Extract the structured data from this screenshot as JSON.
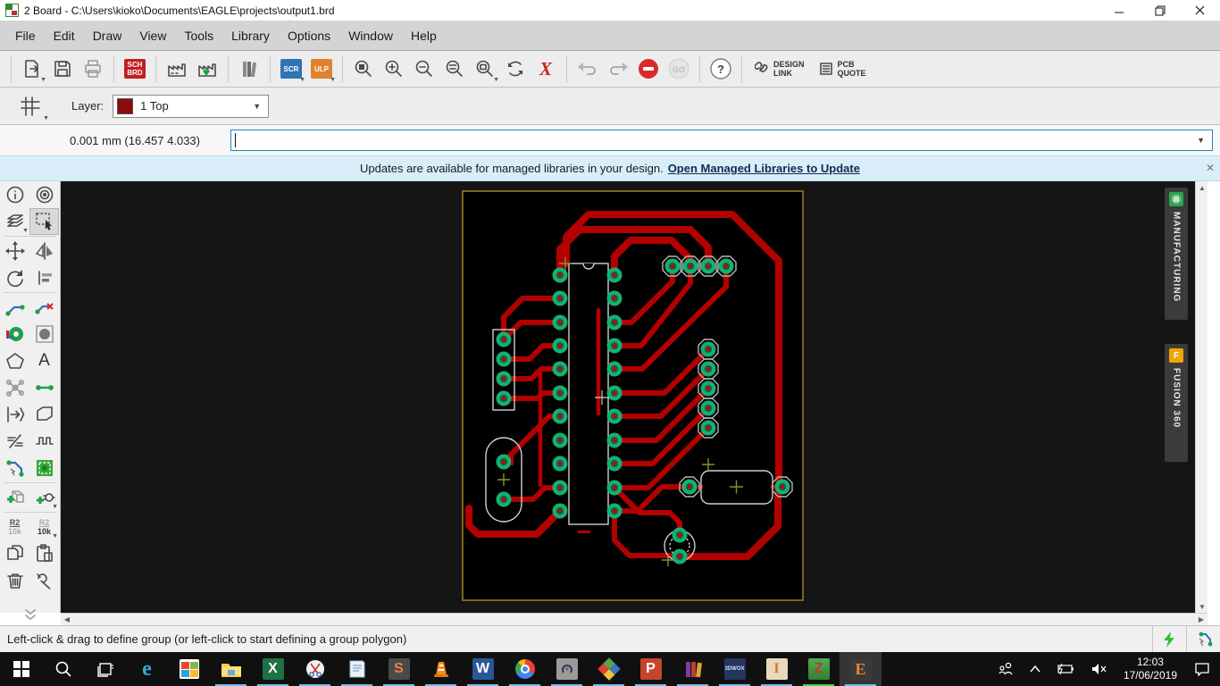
{
  "window": {
    "title": "2 Board - C:\\Users\\kioko\\Documents\\EAGLE\\projects\\output1.brd"
  },
  "menu": {
    "items": [
      "File",
      "Edit",
      "Draw",
      "View",
      "Tools",
      "Library",
      "Options",
      "Window",
      "Help"
    ]
  },
  "toolbar": {
    "sch": "SCH",
    "brd": "BRD",
    "scr": "SCR",
    "ulp": "ULP",
    "go": "GO",
    "help": "?",
    "design_link_1": "DESIGN",
    "design_link_2": "LINK",
    "pcb_quote_1": "PCB",
    "pcb_quote_2": "QUOTE"
  },
  "layer_bar": {
    "label": "Layer:",
    "selected": "1 Top",
    "swatch_color": "#8e0b0b"
  },
  "command_bar": {
    "coords": "0.001 mm (16.457 4.033)",
    "value": ""
  },
  "notification": {
    "message": "Updates are available for managed libraries in your design.",
    "link": "Open Managed Libraries to Update",
    "close": "✕"
  },
  "palette": {
    "name_top": "R2",
    "name_bottom": "10k",
    "value_top": "R2",
    "value_bottom": "10k"
  },
  "side_tabs": {
    "manufacturing": "MANUFACTURING",
    "fusion": "FUSION 360",
    "fusion_icon": "F"
  },
  "status_bar": {
    "hint": "Left-click & drag to define group (or left-click to start defining a group polygon)"
  },
  "taskbar": {
    "time": "12:03",
    "date": "17/06/2019",
    "letters": {
      "edge": "e",
      "excel": "X",
      "sublime": "S",
      "word": "W",
      "powerpoint": "P",
      "threedwox": "3DWOX",
      "i_app": "I",
      "z_app": "Z",
      "eagle": "E"
    }
  },
  "colors": {
    "trace_red": "#b30000",
    "pad_green": "#14b074",
    "board_outline": "#9a8420",
    "accent_blue": "#1c88c7"
  }
}
